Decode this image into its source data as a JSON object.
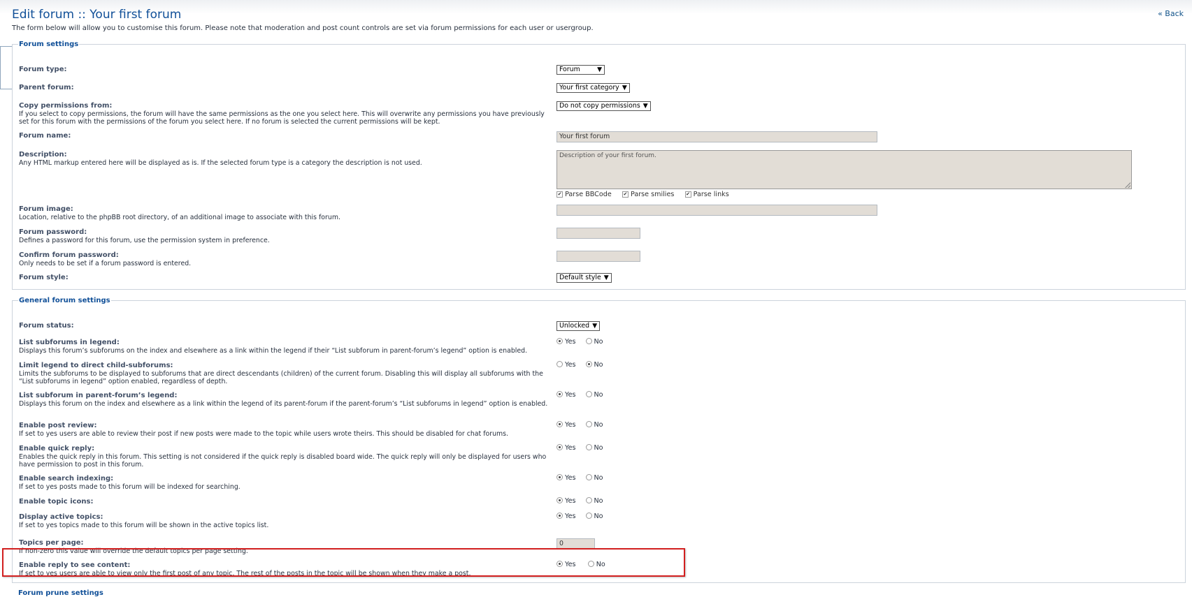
{
  "header": {
    "title": "Edit forum :: Your first forum",
    "intro": "The form below will allow you to customise this forum. Please note that moderation and post count controls are set via forum permissions for each user or usergroup.",
    "back_label": "« Back"
  },
  "forum_settings": {
    "legend": "Forum settings",
    "forum_type": {
      "label": "Forum type:",
      "value": "Forum"
    },
    "parent_forum": {
      "label": "Parent forum:",
      "value": "Your first category"
    },
    "copy_permissions": {
      "label": "Copy permissions from:",
      "explain": "If you select to copy permissions, the forum will have the same permissions as the one you select here. This will overwrite any permissions you have previously set for this forum with the permissions of the forum you select here. If no forum is selected the current permissions will be kept.",
      "value": "Do not copy permissions"
    },
    "forum_name": {
      "label": "Forum name:",
      "value": "Your first forum"
    },
    "description": {
      "label": "Description:",
      "explain": "Any HTML markup entered here will be displayed as is. If the selected forum type is a category the description is not used.",
      "value": "Description of your first forum.",
      "parse_bbcode": "Parse BBCode",
      "parse_smilies": "Parse smilies",
      "parse_links": "Parse links"
    },
    "forum_image": {
      "label": "Forum image:",
      "explain": "Location, relative to the phpBB root directory, of an additional image to associate with this forum.",
      "value": ""
    },
    "forum_password": {
      "label": "Forum password:",
      "explain": "Defines a password for this forum, use the permission system in preference."
    },
    "confirm_password": {
      "label": "Confirm forum password:",
      "explain": "Only needs to be set if a forum password is entered."
    },
    "forum_style": {
      "label": "Forum style:",
      "value": "Default style"
    }
  },
  "general_settings": {
    "legend": "General forum settings",
    "yes_label": "Yes",
    "no_label": "No",
    "forum_status": {
      "label": "Forum status:",
      "value": "Unlocked"
    },
    "rows": [
      {
        "label": "List subforums in legend:",
        "explain": "Displays this forum’s subforums on the index and elsewhere as a link within the legend if their “List subforum in parent-forum’s legend” option is enabled.",
        "selected": "yes"
      },
      {
        "label": "Limit legend to direct child-subforums:",
        "explain": "Limits the subforums to be displayed to subforums that are direct descendants (children) of the current forum. Disabling this will display all subforums with the “List subforums in legend” option enabled, regardless of depth.",
        "selected": "no"
      },
      {
        "label": "List subforum in parent-forum’s legend:",
        "explain": "Displays this forum on the index and elsewhere as a link within the legend of its parent-forum if the parent-forum’s “List subforums in legend” option is enabled.",
        "selected": "yes"
      },
      {
        "label": "Enable post review:",
        "explain": "If set to yes users are able to review their post if new posts were made to the topic while users wrote theirs. This should be disabled for chat forums.",
        "selected": "yes"
      },
      {
        "label": "Enable quick reply:",
        "explain": "Enables the quick reply in this forum. This setting is not considered if the quick reply is disabled board wide. The quick reply will only be displayed for users who have permission to post in this forum.",
        "selected": "yes"
      },
      {
        "label": "Enable search indexing:",
        "explain": "If set to yes posts made to this forum will be indexed for searching.",
        "selected": "yes"
      },
      {
        "label": "Enable topic icons:",
        "explain": "",
        "selected": "yes"
      },
      {
        "label": "Display active topics:",
        "explain": "If set to yes topics made to this forum will be shown in the active topics list.",
        "selected": "yes"
      }
    ],
    "topics_per_page": {
      "label": "Topics per page:",
      "explain": "If non-zero this value will override the default topics per page setting.",
      "value": "0"
    },
    "reply_to_see": {
      "label": "Enable reply to see content:",
      "explain": "If set to yes users are able to view only the first post of any topic. The rest of the posts in the topic will be shown when they make a post.",
      "selected": "yes"
    }
  },
  "prune": {
    "legend": "Forum prune settings"
  },
  "colors": {
    "heading": "#115098",
    "highlight": "#d21f1f",
    "field_bg": "#e2ddd6"
  }
}
